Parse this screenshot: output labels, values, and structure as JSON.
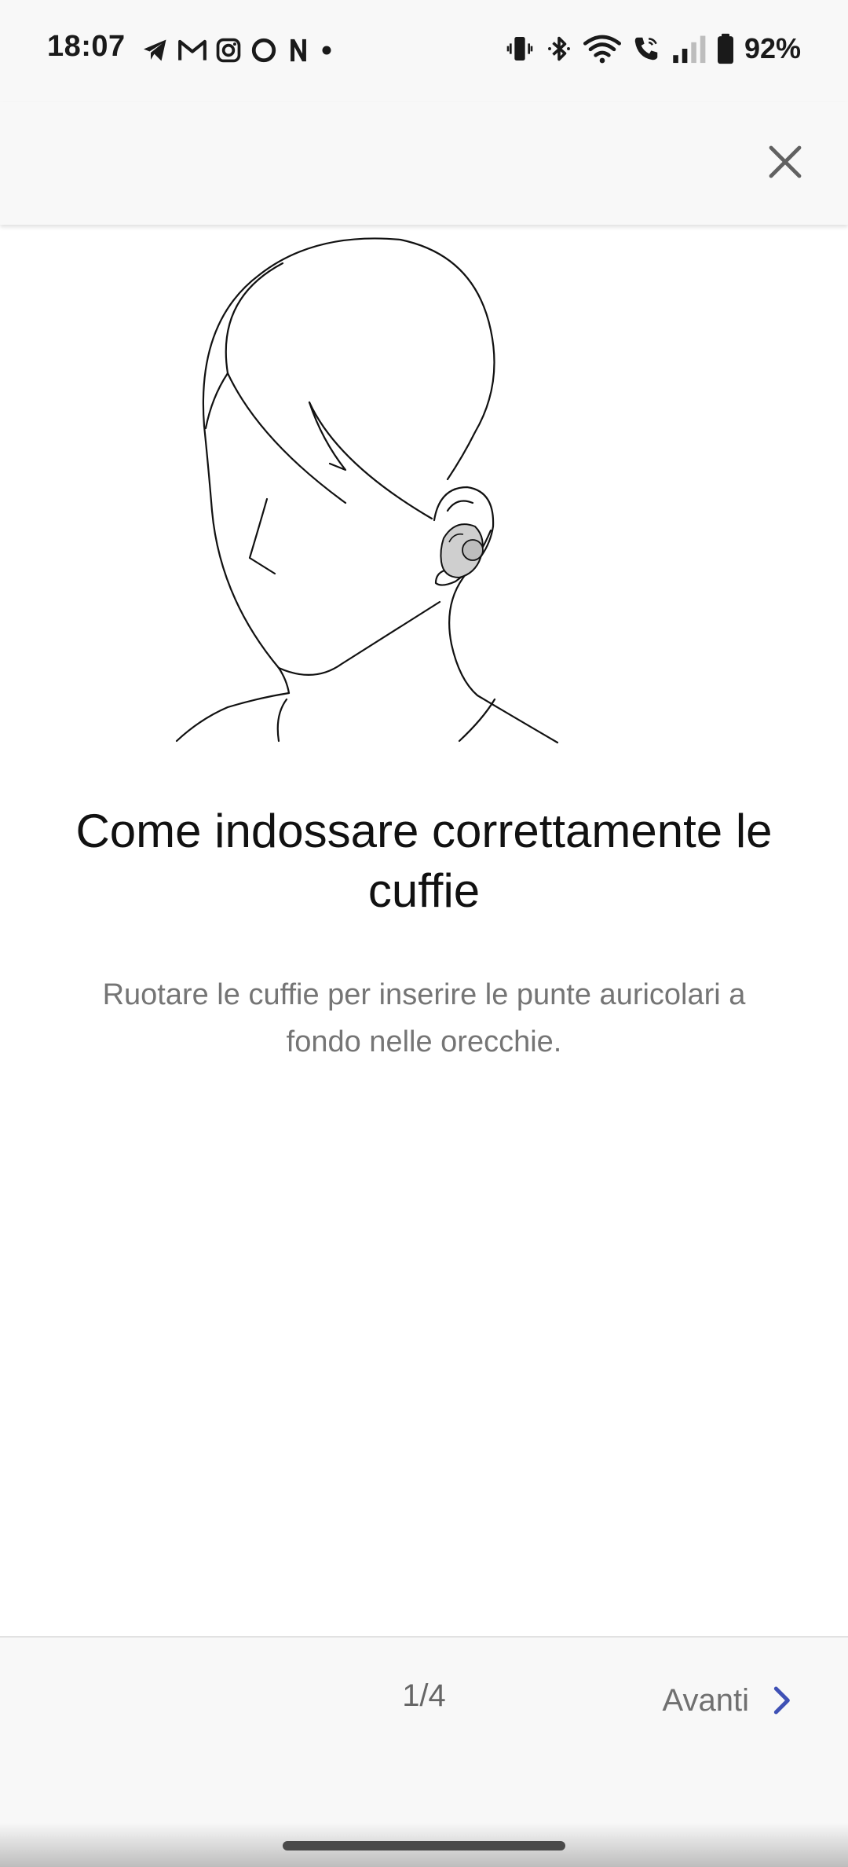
{
  "status_bar": {
    "time": "18:07",
    "battery": "92%",
    "left_icons": [
      "telegram-icon",
      "gmail-icon",
      "instagram-icon",
      "circle-app-icon",
      "netflix-icon",
      "notification-dot-icon"
    ],
    "right_icons": [
      "vibrate-icon",
      "bluetooth-icon",
      "wifi-icon",
      "wifi-calling-icon",
      "signal-icon",
      "battery-icon"
    ]
  },
  "top_bar": {
    "close_icon": "close-icon"
  },
  "content": {
    "title": "Come indossare correttamente le cuffie",
    "description": "Ruotare le cuffie per inserire le punte auricolari a fondo nelle orecchie."
  },
  "bottom_bar": {
    "page_indicator": "1/4",
    "next_label": "Avanti",
    "next_icon": "chevron-right-icon"
  },
  "colors": {
    "accent": "#3f51b5",
    "background": "#ffffff",
    "bar_background": "#f8f8f8",
    "text_primary": "#111111",
    "text_secondary": "#757575"
  }
}
